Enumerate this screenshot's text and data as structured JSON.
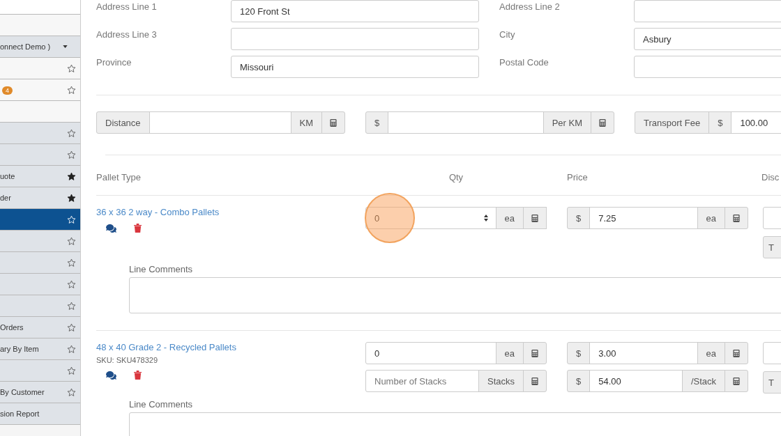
{
  "sidebar": {
    "items": [
      {
        "kind": "blank",
        "selected": false
      },
      {
        "kind": "blank",
        "selected": false
      },
      {
        "kind": "dropdown",
        "text": "onnect Demo )",
        "selected": false
      },
      {
        "kind": "top",
        "starred": false,
        "selected": false
      },
      {
        "kind": "top",
        "badge": "4",
        "starred": false,
        "selected": false
      },
      {
        "kind": "blank",
        "selected": false
      },
      {
        "kind": "link",
        "starred": false,
        "selected": false
      },
      {
        "kind": "link",
        "starred": false,
        "selected": false
      },
      {
        "kind": "link",
        "text": "uote",
        "starred": true,
        "selected": false
      },
      {
        "kind": "link",
        "text": "der",
        "starred": true,
        "selected": false
      },
      {
        "kind": "link",
        "starred": false,
        "selected": true
      },
      {
        "kind": "link",
        "starred": false,
        "selected": false
      },
      {
        "kind": "link",
        "starred": false,
        "selected": false
      },
      {
        "kind": "link",
        "starred": false,
        "selected": false
      },
      {
        "kind": "link",
        "starred": false,
        "selected": false
      },
      {
        "kind": "link",
        "text": "Orders",
        "starred": false,
        "selected": false
      },
      {
        "kind": "link",
        "text": "ary By Item",
        "starred": false,
        "selected": false
      },
      {
        "kind": "link",
        "starred": false,
        "selected": false
      },
      {
        "kind": "link",
        "text": "By Customer",
        "starred": false,
        "selected": false
      },
      {
        "kind": "report",
        "text": "sion Report",
        "selected": false
      }
    ]
  },
  "address": [
    [
      {
        "label": "Address Line 1",
        "value": "120 Front St"
      },
      {
        "label": "Address Line 2"
      }
    ],
    [
      {
        "label": "Address Line 3"
      },
      {
        "label": "City",
        "value": "Asbury"
      }
    ],
    [
      {
        "label": "Province",
        "value": "Missouri"
      },
      {
        "label": "Postal Code"
      }
    ]
  ],
  "fees": [
    [
      {
        "kind": "addon",
        "text": "Distance"
      },
      {
        "kind": "input"
      },
      {
        "kind": "addon",
        "text": "KM"
      },
      {
        "kind": "calc"
      }
    ],
    [
      {
        "kind": "addon",
        "text": "$"
      },
      {
        "kind": "input"
      },
      {
        "kind": "addon",
        "text": "Per KM"
      },
      {
        "kind": "calc"
      }
    ],
    [
      {
        "kind": "addon",
        "text": "Transport Fee"
      },
      {
        "kind": "addon",
        "text": "$"
      },
      {
        "kind": "input",
        "value": "100.00"
      }
    ]
  ],
  "table": {
    "columns": [
      "Pallet Type",
      "Qty",
      "Price",
      "Disc"
    ],
    "rows": [
      {
        "name": "36 x 36 2 way - Combo Pallets",
        "comments_label": "Line Comments",
        "tail_button": "T",
        "qty": [
          [
            {
              "kind": "input",
              "value": "0",
              "spinner": true,
              "highlighted": true
            },
            {
              "kind": "addon",
              "text": "ea"
            },
            {
              "kind": "calc"
            }
          ]
        ],
        "price": [
          [
            {
              "kind": "addon",
              "text": "$"
            },
            {
              "kind": "input",
              "value": "7.25"
            },
            {
              "kind": "addon",
              "text": "ea"
            },
            {
              "kind": "calc"
            }
          ]
        ]
      },
      {
        "name": "48 x 40 Grade 2 - Recycled Pallets",
        "sku": "SKU: SKU478329",
        "comments_label": "Line Comments",
        "tail_button": "T",
        "qty": [
          [
            {
              "kind": "input",
              "value": "0"
            },
            {
              "kind": "addon",
              "text": "ea"
            },
            {
              "kind": "calc"
            }
          ],
          [
            {
              "kind": "input",
              "placeholder": "Number of Stacks"
            },
            {
              "kind": "addon",
              "text": "Stacks"
            },
            {
              "kind": "calc"
            }
          ]
        ],
        "price": [
          [
            {
              "kind": "addon",
              "text": "$"
            },
            {
              "kind": "input",
              "value": "3.00"
            },
            {
              "kind": "addon",
              "text": "ea"
            },
            {
              "kind": "calc"
            }
          ],
          [
            {
              "kind": "addon",
              "text": "$"
            },
            {
              "kind": "input",
              "value": "54.00"
            },
            {
              "kind": "addon",
              "text": "/Stack"
            },
            {
              "kind": "calc"
            }
          ]
        ]
      }
    ]
  }
}
